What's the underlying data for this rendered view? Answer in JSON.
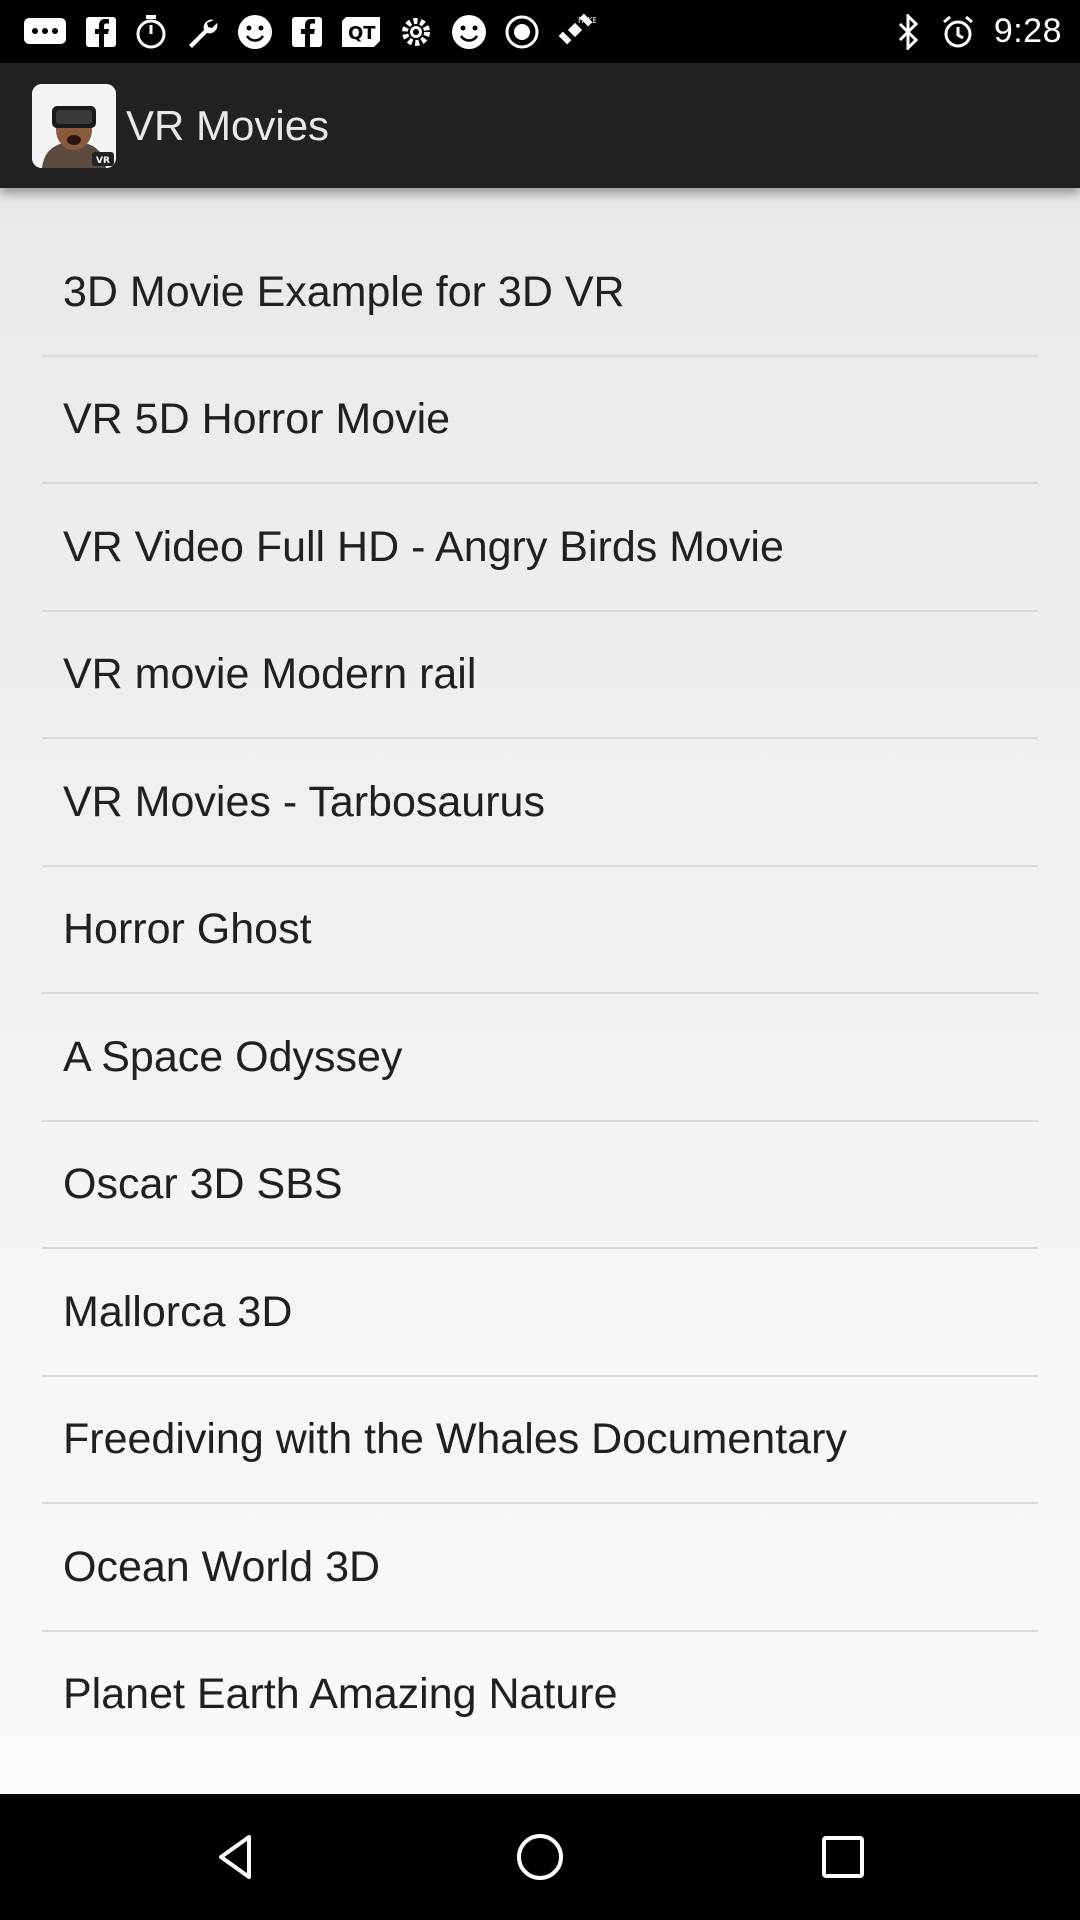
{
  "status_bar": {
    "time": "9:28",
    "left_icons": [
      "chat-icon",
      "facebook-icon",
      "timer-icon",
      "wrench-icon",
      "smiley-icon",
      "facebook-icon",
      "qt-icon",
      "gear-icon",
      "smiley-icon",
      "record-icon",
      "satellite-icon"
    ],
    "right_icons": [
      "bluetooth-icon",
      "alarm-icon"
    ]
  },
  "app_bar": {
    "title": "VR Movies",
    "icon_badge": "VR"
  },
  "movies": [
    {
      "label": "3D Movie Example for 3D VR"
    },
    {
      "label": "VR 5D Horror Movie"
    },
    {
      "label": "VR Video Full HD - Angry Birds Movie"
    },
    {
      "label": "VR movie Modern rail"
    },
    {
      "label": "VR Movies - Tarbosaurus"
    },
    {
      "label": "Horror Ghost"
    },
    {
      "label": "A Space Odyssey"
    },
    {
      "label": "Oscar 3D SBS"
    },
    {
      "label": "Mallorca 3D"
    },
    {
      "label": "Freediving with the Whales Documentary"
    },
    {
      "label": "Ocean World 3D"
    },
    {
      "label": "Planet Earth Amazing Nature"
    }
  ],
  "nav_bar": {
    "buttons": [
      "back-icon",
      "home-icon",
      "recents-icon"
    ]
  },
  "colors": {
    "app_bar": "#212121",
    "status_bar": "#000000",
    "list_text": "#202020",
    "divider": "#d9d9d9"
  }
}
